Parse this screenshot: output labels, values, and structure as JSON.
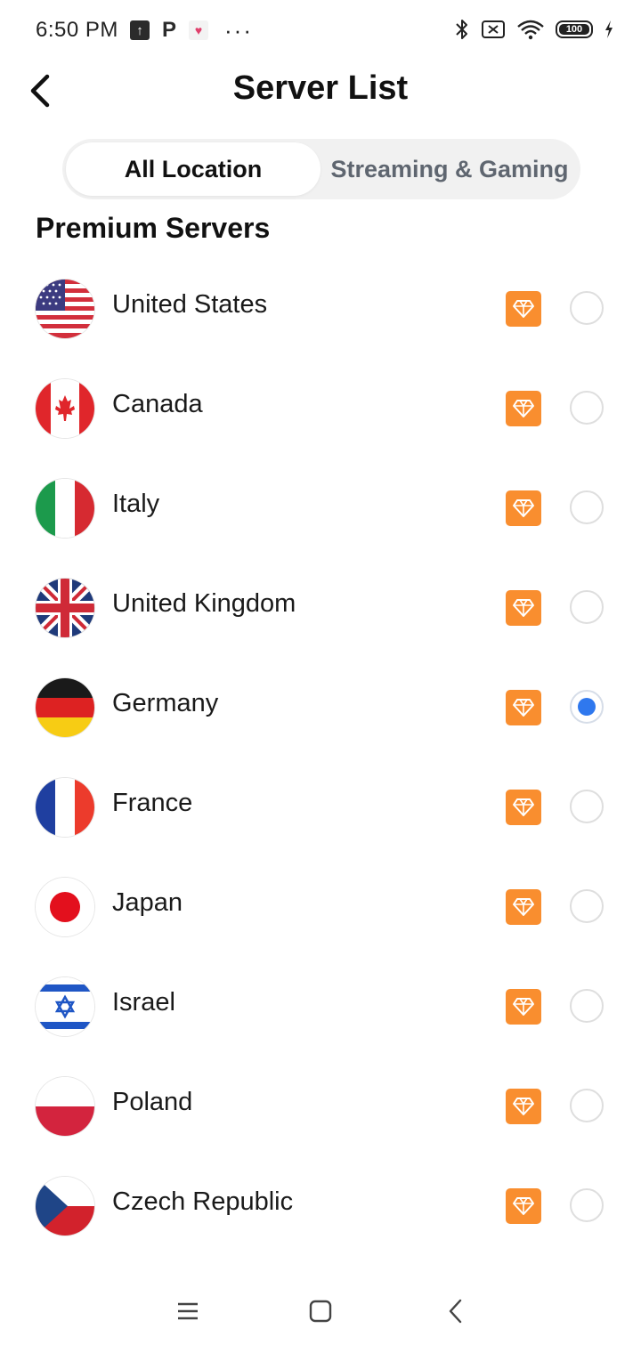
{
  "status_bar": {
    "time": "6:50 PM",
    "left_icons": [
      "upload-icon",
      "p-app-icon",
      "heart-app-icon"
    ],
    "more": "···",
    "right_icons": [
      "bluetooth-icon",
      "sim-off-icon",
      "wifi-icon",
      "battery-icon",
      "charging-icon"
    ],
    "battery_level": "100"
  },
  "header": {
    "back_icon": "chevron-left-icon",
    "title": "Server List"
  },
  "tabs": [
    {
      "label": "All Location",
      "active": true
    },
    {
      "label": "Streaming & Gaming",
      "active": false
    }
  ],
  "section": {
    "title": "Premium Servers"
  },
  "colors": {
    "accent": "#2f78ee",
    "premium_badge": "#f98e2f",
    "tab_bg": "#f1f1f1"
  },
  "servers": [
    {
      "name": "United States",
      "flag": "us-flag-icon",
      "premium": true,
      "selected": false
    },
    {
      "name": "Canada",
      "flag": "ca-flag-icon",
      "premium": true,
      "selected": false
    },
    {
      "name": "Italy",
      "flag": "it-flag-icon",
      "premium": true,
      "selected": false
    },
    {
      "name": "United Kingdom",
      "flag": "uk-flag-icon",
      "premium": true,
      "selected": false
    },
    {
      "name": "Germany",
      "flag": "de-flag-icon",
      "premium": true,
      "selected": true
    },
    {
      "name": "France",
      "flag": "fr-flag-icon",
      "premium": true,
      "selected": false
    },
    {
      "name": "Japan",
      "flag": "jp-flag-icon",
      "premium": true,
      "selected": false
    },
    {
      "name": "Israel",
      "flag": "il-flag-icon",
      "premium": true,
      "selected": false
    },
    {
      "name": "Poland",
      "flag": "pl-flag-icon",
      "premium": true,
      "selected": false
    },
    {
      "name": "Czech Republic",
      "flag": "cz-flag-icon",
      "premium": true,
      "selected": false
    }
  ],
  "nav_bar": {
    "buttons": [
      "menu-icon",
      "home-icon",
      "back-icon"
    ]
  }
}
